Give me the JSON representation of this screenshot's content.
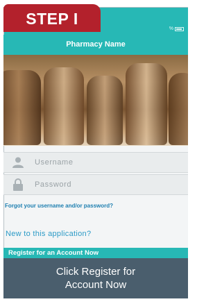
{
  "step_label": "STEP I",
  "status_bar": {
    "text": "%"
  },
  "app": {
    "title": "Pharmacy Name"
  },
  "hero": {
    "image": "pharmacy-bottles-photo"
  },
  "login": {
    "username_placeholder": "Username",
    "password_placeholder": "Password",
    "username_icon": "user-icon",
    "password_icon": "lock-icon",
    "forgot_link": "Forgot your username and/or password?"
  },
  "signup": {
    "prompt": "New to this application?",
    "register_label": "Register for an Account Now"
  },
  "caption": {
    "line1": "Click Register for",
    "line2": "Account Now"
  },
  "colors": {
    "teal": "#27b8b5",
    "step_red": "#b3212c",
    "caption_bg": "#4a5e6d",
    "link_blue": "#1e7fb0"
  }
}
